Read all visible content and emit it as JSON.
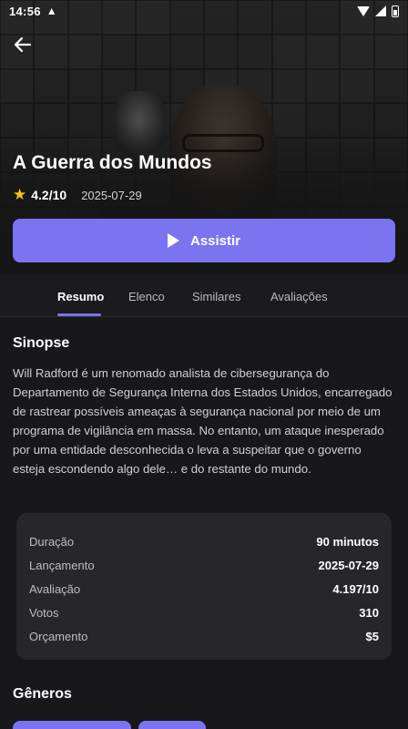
{
  "status_bar": {
    "time": "14:56",
    "warning_icon": "warning-icon",
    "wifi_icon": "wifi-icon",
    "signal_icon": "signal-icon",
    "battery_icon": "battery-icon"
  },
  "header": {
    "back_icon": "arrow-left-icon"
  },
  "movie": {
    "title": "A Guerra dos Mundos",
    "rating": "4.2/10",
    "release_date": "2025-07-29",
    "star_icon": "star-icon",
    "star_color": "#f5c518"
  },
  "watch_button": {
    "label": "Assistir",
    "icon": "play-icon",
    "color": "#7b73f0"
  },
  "tabs": [
    {
      "label": "Resumo",
      "active": true
    },
    {
      "label": "Elenco",
      "active": false
    },
    {
      "label": "Similares",
      "active": false
    },
    {
      "label": "Avaliações",
      "active": false
    }
  ],
  "synopsis": {
    "title": "Sinopse",
    "text": "Will Radford é um renomado analista de cibersegurança do Departamento de Segurança Interna dos Estados Unidos, encarregado de rastrear possíveis ameaças à segurança nacional por meio de um programa de vigilância em massa. No entanto, um ataque inesperado por uma entidade desconhecida o leva a suspeitar que o governo esteja escondendo algo dele… e do restante do mundo."
  },
  "details": [
    {
      "label": "Duração",
      "value": "90 minutos"
    },
    {
      "label": "Lançamento",
      "value": "2025-07-29"
    },
    {
      "label": "Avaliação",
      "value": "4.197/10"
    },
    {
      "label": "Votos",
      "value": "310"
    },
    {
      "label": "Orçamento",
      "value": "$5"
    }
  ],
  "genres": {
    "title": "Gêneros"
  }
}
